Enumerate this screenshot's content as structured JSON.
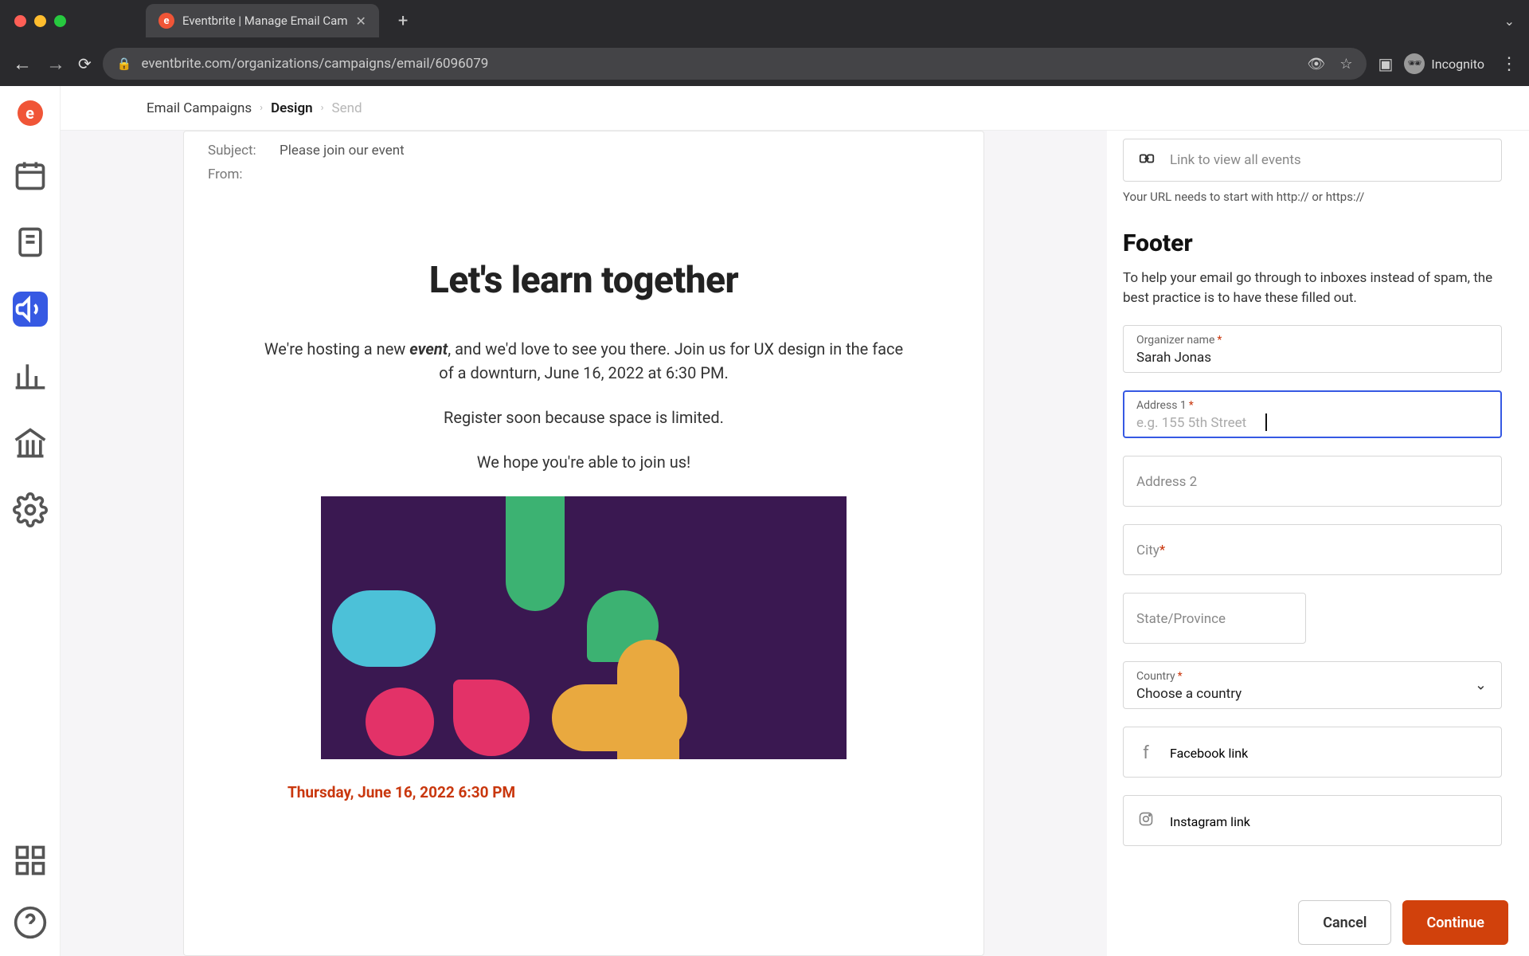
{
  "browser": {
    "tab_title": "Eventbrite | Manage Email Cam",
    "url": "eventbrite.com/organizations/campaigns/email/6096079",
    "incognito_label": "Incognito"
  },
  "breadcrumbs": {
    "a": "Email Campaigns",
    "b": "Design",
    "c": "Send"
  },
  "email": {
    "subject_label": "Subject:",
    "subject_value": "Please join our event",
    "from_label": "From:",
    "hero_title": "Let's learn together",
    "p1_a": "We're hosting a new ",
    "p1_b_strong": "event",
    "p1_c": ", and we'd love to see you there. Join us for UX design in the face of a downturn, June 16, 2022 at 6:30 PM.",
    "p2": "Register soon because space is limited.",
    "p3": "We hope you're able to join us!",
    "date_line": "Thursday, June 16, 2022 6:30 PM"
  },
  "side": {
    "link_all_events": "Link to view all events",
    "url_hint": "Your URL needs to start with http:// or https://",
    "footer_heading": "Footer",
    "footer_desc": "To help your email go through to inboxes instead of spam, the best practice is to have these filled out.",
    "organizer_label": "Organizer name",
    "organizer_value": "Sarah Jonas",
    "address1_label": "Address 1",
    "address1_placeholder": "e.g. 155 5th Street",
    "address2_label": "Address 2",
    "city_label": "City",
    "state_label": "State/Province",
    "country_label": "Country",
    "country_value": "Choose a country",
    "facebook_label": "Facebook link",
    "instagram_label": "Instagram link"
  },
  "actions": {
    "cancel": "Cancel",
    "continue": "Continue"
  }
}
